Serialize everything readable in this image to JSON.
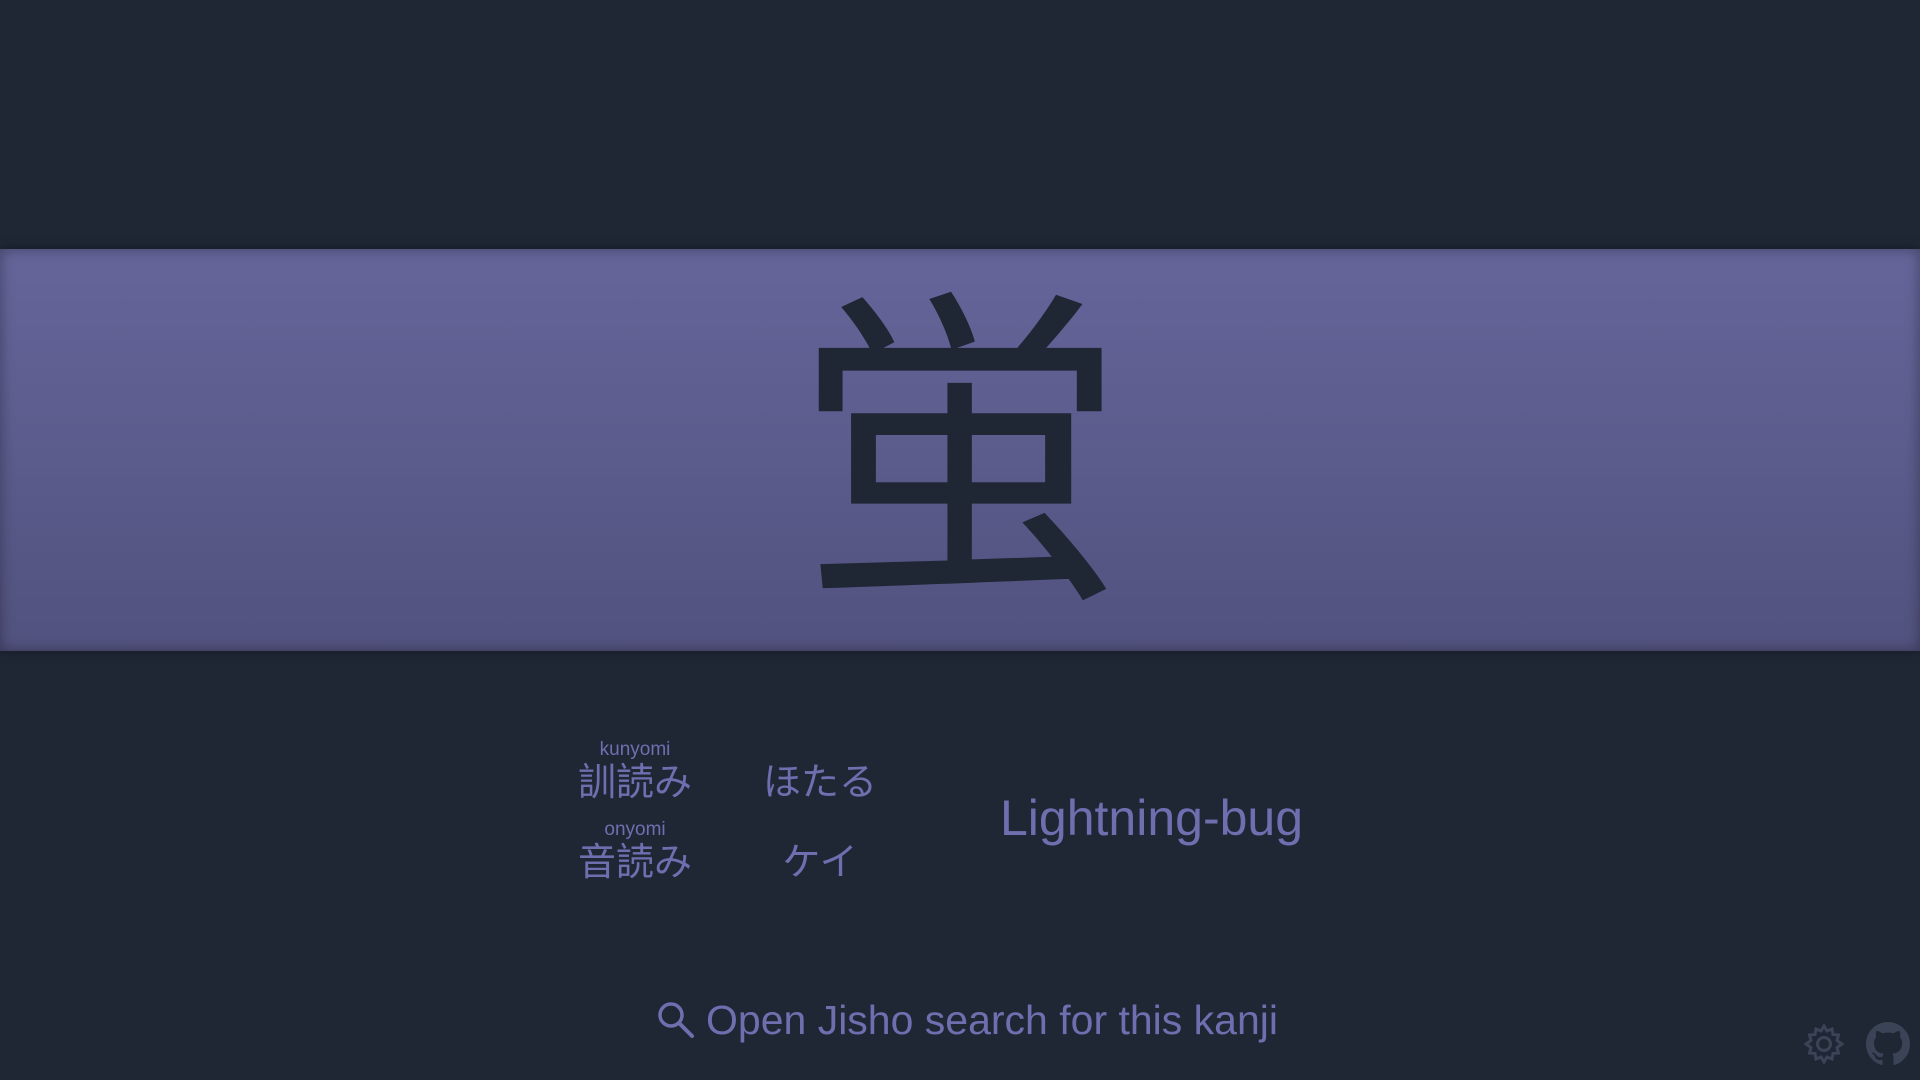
{
  "kanji": {
    "character": "蛍"
  },
  "readings": {
    "kunyomi": {
      "furigana": "kunyomi",
      "label": "訓読み",
      "value": "ほたる"
    },
    "onyomi": {
      "furigana": "onyomi",
      "label": "音読み",
      "value": "ケイ"
    }
  },
  "meaning": "Lightning-bug",
  "jisho_link": {
    "label": "Open Jisho search for this kanji",
    "icon": "search-icon"
  },
  "corner": {
    "settings_icon": "gear-icon",
    "github_icon": "github-icon"
  },
  "colors": {
    "background": "#1f2735",
    "band_top": "#65659a",
    "band_bottom": "#52527f",
    "accent_text": "#6f6fb0"
  }
}
